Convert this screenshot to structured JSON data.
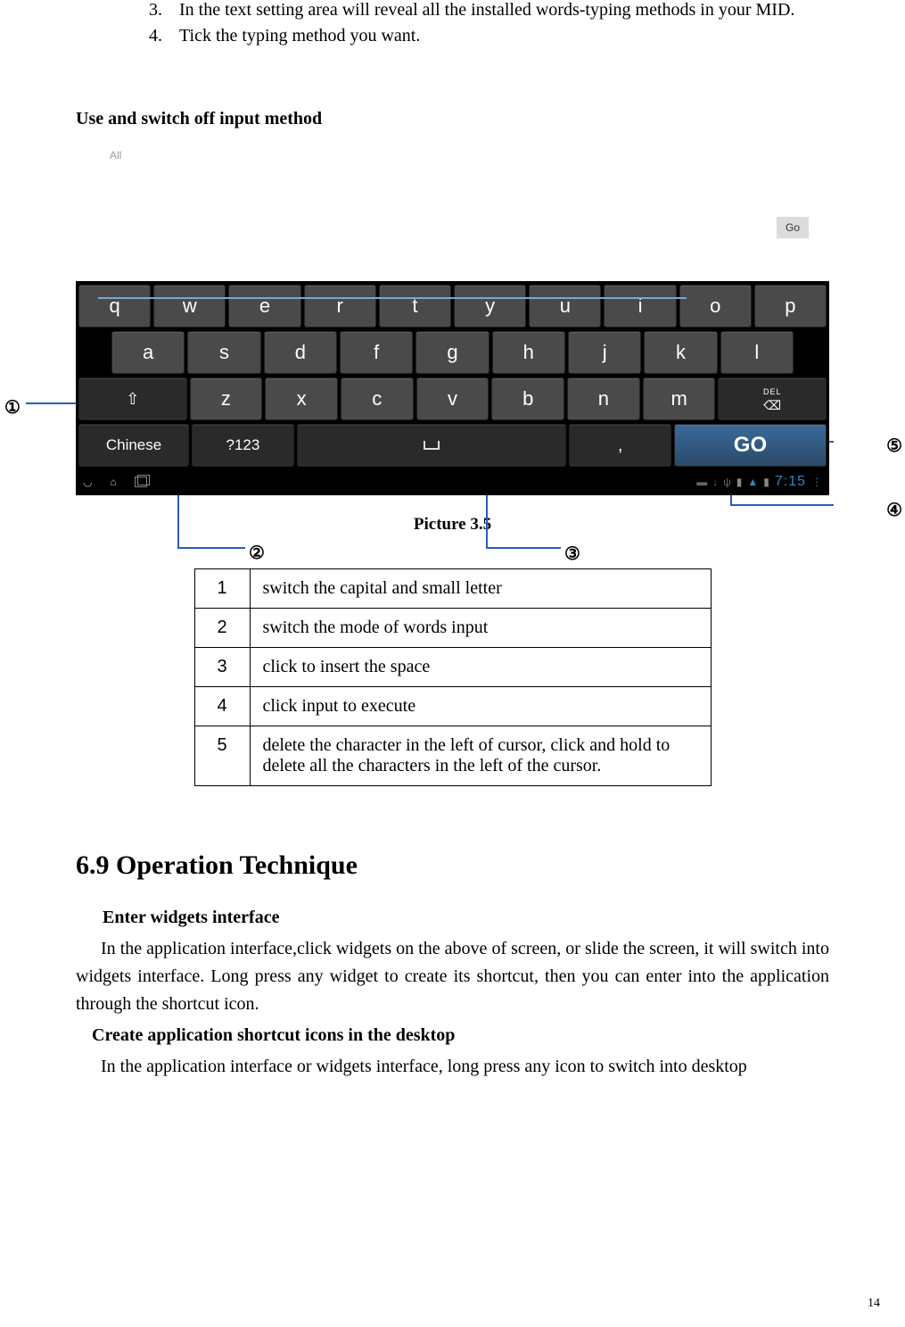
{
  "list": {
    "item3_num": "3.",
    "item3_text": "In the text setting area will reveal all the installed words-typing methods in your MID.",
    "item4_num": "4.",
    "item4_text": "Tick the typing method you want."
  },
  "section1_title": "Use and switch off input method",
  "screenshot": {
    "all_label": "All",
    "go_label": "Go",
    "row1": [
      "q",
      "w",
      "e",
      "r",
      "t",
      "y",
      "u",
      "i",
      "o",
      "p"
    ],
    "row2": [
      "a",
      "s",
      "d",
      "f",
      "g",
      "h",
      "j",
      "k",
      "l"
    ],
    "row3": {
      "z": "z",
      "x": "x",
      "c": "c",
      "v": "v",
      "b": "b",
      "n": "n",
      "m": "m"
    },
    "del_label": "DEL",
    "chinese": "Chinese",
    "num_mode": "?123",
    "comma": ",",
    "go": "GO",
    "time": "7:15"
  },
  "caption": "Picture 3.5",
  "callouts": {
    "c1": "①",
    "c2": "②",
    "c3": "③",
    "c4": "④",
    "c5": "⑤"
  },
  "table": {
    "r1n": "1",
    "r1t": "switch the capital and small letter",
    "r2n": "2",
    "r2t": "switch the mode of words input",
    "r3n": "3",
    "r3t": "click to insert the space",
    "r4n": "4",
    "r4t": "click input to execute",
    "r5n": "5",
    "r5t": "delete the character in the left of cursor, click and hold to delete all the characters in the left of the cursor."
  },
  "h2": "6.9 Operation Technique",
  "sub1": "Enter widgets interface",
  "para1": "In the application interface,click widgets on the above of screen, or slide the screen, it will switch into widgets interface. Long press any widget to create its shortcut, then you can enter into the application through the shortcut icon.",
  "sub2": "Create application shortcut icons in the desktop",
  "para2": "In the application interface or widgets interface, long press any icon to switch into desktop",
  "page_num": "14"
}
